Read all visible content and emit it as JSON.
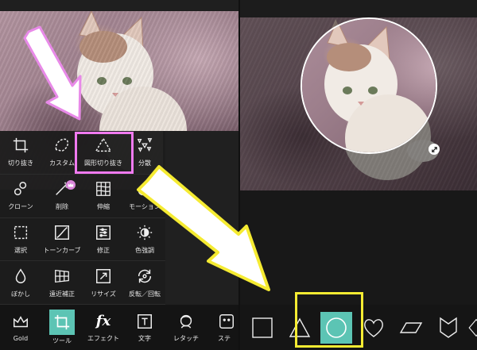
{
  "tool_menu": {
    "items": [
      {
        "label": "切り抜き",
        "icon": "crop-icon"
      },
      {
        "label": "カスタム",
        "icon": "custom-cut-icon"
      },
      {
        "label": "図形切り抜き",
        "icon": "shape-crop-icon"
      },
      {
        "label": "分散",
        "icon": "disperse-icon"
      },
      {
        "label": "クローン",
        "icon": "clone-icon"
      },
      {
        "label": "削除",
        "icon": "remove-icon"
      },
      {
        "label": "伸縮",
        "icon": "stretch-icon"
      },
      {
        "label": "モーション",
        "icon": "motion-icon"
      },
      {
        "label": "選択",
        "icon": "select-icon"
      },
      {
        "label": "トーンカーブ",
        "icon": "curves-icon"
      },
      {
        "label": "修正",
        "icon": "adjust-icon"
      },
      {
        "label": "色強調",
        "icon": "enhance-icon"
      },
      {
        "label": "ぼかし",
        "icon": "blur-icon"
      },
      {
        "label": "遠近補正",
        "icon": "perspective-icon"
      },
      {
        "label": "リサイズ",
        "icon": "resize-icon"
      },
      {
        "label": "反転／回転",
        "icon": "flip-rotate-icon"
      }
    ]
  },
  "bottom_toolbar": {
    "items": [
      {
        "label": "Gold",
        "icon": "crown-icon"
      },
      {
        "label": "ツール",
        "icon": "crop-tool-icon"
      },
      {
        "label": "エフェクト",
        "icon": "fx-icon",
        "glyph": "fx"
      },
      {
        "label": "文字",
        "icon": "text-icon"
      },
      {
        "label": "レタッチ",
        "icon": "retouch-icon"
      },
      {
        "label": "ステ",
        "icon": "sticker-icon"
      }
    ]
  },
  "shapes": [
    "square",
    "triangle",
    "circle",
    "heart",
    "parallelogram",
    "chevron",
    "diamond"
  ],
  "colors": {
    "accent": "#5cc4b4",
    "highlight_pink": "#f07af0",
    "highlight_yellow": "#f5eb32",
    "badge": "#d985d9"
  }
}
